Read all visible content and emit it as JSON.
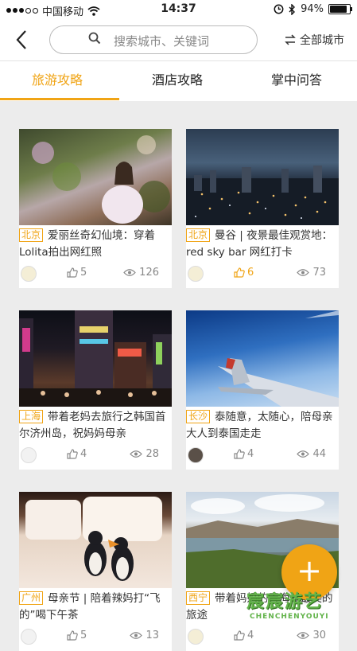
{
  "status_bar": {
    "carrier": "中国移动",
    "time": "14:37",
    "battery": "94%",
    "battery_level": 0.94,
    "icons": [
      "signal-dots-icon",
      "wifi-icon",
      "alarm-icon",
      "bluetooth-icon",
      "battery-icon"
    ]
  },
  "nav": {
    "back_icon": "chevron-left-icon",
    "search_placeholder": "搜索城市、关键词",
    "all_city": "全部城市"
  },
  "tabs": [
    {
      "label": "旅游攻略",
      "active": true
    },
    {
      "label": "酒店攻略",
      "active": false
    },
    {
      "label": "掌中问答",
      "active": false
    }
  ],
  "cards": [
    {
      "city": "北京",
      "title": "爱丽丝奇幻仙境：穿着Lolita拍出网红照",
      "likes": "5",
      "views": "126",
      "liked": false
    },
    {
      "city": "北京",
      "title": "曼谷 | 夜景最佳观赏地：red sky bar 网红打卡",
      "likes": "6",
      "views": "73",
      "liked": true
    },
    {
      "city": "上海",
      "title": "带着老妈去旅行之韩国首尔济州岛，祝妈妈母亲",
      "likes": "4",
      "views": "28",
      "liked": false
    },
    {
      "city": "长沙",
      "title": "泰随意，太随心，陪母亲大人到泰国走走",
      "likes": "4",
      "views": "44",
      "liked": false
    },
    {
      "city": "广州",
      "title": "母亲节 | 陪着辣妈打“飞的”喝下午茶",
      "likes": "5",
      "views": "13",
      "liked": false
    },
    {
      "city": "西宁",
      "title": "带着妈妈的青海湖最美的旅途",
      "likes": "4",
      "views": "30",
      "liked": false
    }
  ],
  "fab_label": "+",
  "watermark": {
    "cn": "宸宸游艺",
    "en": "CHENCHENYOUYI"
  },
  "colors": {
    "accent": "#f0a415",
    "background": "#ececec",
    "watermark": "#62b34a"
  }
}
